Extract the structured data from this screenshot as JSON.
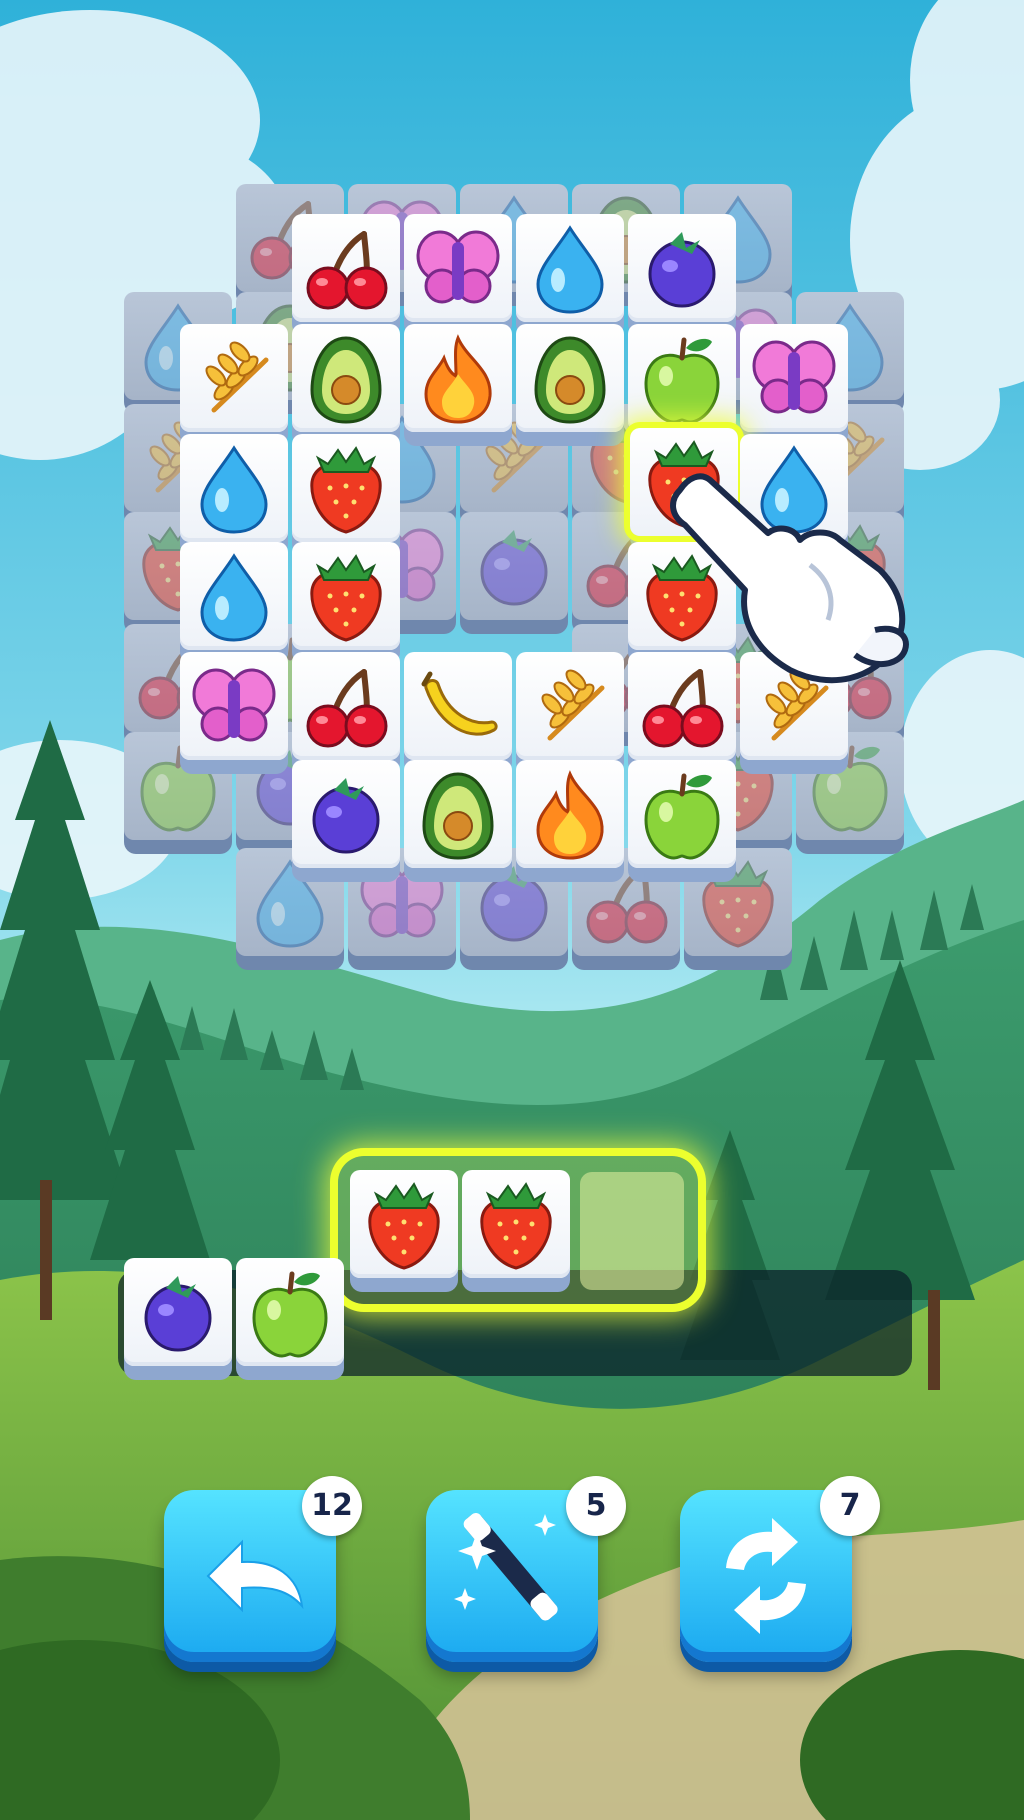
{
  "game": {
    "title": "",
    "highlight_color": "#ecff2e",
    "tray_color": "#0a1e28"
  },
  "boosters": {
    "undo": {
      "icon": "undo-arrow-icon",
      "count": "12"
    },
    "magic_wand": {
      "icon": "magic-wand-icon",
      "count": "5"
    },
    "shuffle": {
      "icon": "shuffle-icon",
      "count": "7"
    }
  },
  "tile_types": [
    "cherry",
    "butterfly",
    "water-drop",
    "blueberry",
    "wheat",
    "avocado",
    "flame",
    "apple",
    "strawberry",
    "banana"
  ],
  "board": {
    "back_tiles": [
      "cherry",
      "butterfly",
      "water-drop",
      "avocado",
      "water-drop",
      "water-drop",
      "avocado",
      "butterfly",
      "water-drop",
      "wheat",
      "water-drop",
      "wheat",
      "strawberry",
      "wheat",
      "strawberry",
      "butterfly",
      "blueberry",
      "cherry",
      "strawberry",
      "cherry",
      "apple",
      "cherry",
      "strawberry",
      "cherry",
      "apple",
      "blueberry",
      "strawberry",
      "apple",
      "water-drop",
      "butterfly",
      "blueberry",
      "cherry",
      "strawberry"
    ],
    "front_tiles": [
      "cherry",
      "butterfly",
      "water-drop",
      "blueberry",
      "wheat",
      "avocado",
      "flame",
      "avocado",
      "apple",
      "butterfly",
      "water-drop",
      "strawberry",
      "strawberry",
      "water-drop",
      "water-drop",
      "strawberry",
      "strawberry",
      "butterfly",
      "cherry",
      "banana",
      "wheat",
      "cherry",
      "wheat",
      "blueberry",
      "avocado",
      "flame",
      "apple"
    ],
    "highlighted_tile": "strawberry"
  },
  "tray": {
    "capacity": 7,
    "collected": [
      "blueberry",
      "apple"
    ],
    "incoming": [
      "strawberry",
      "strawberry"
    ]
  },
  "tutorial": {
    "pointer_icon": "pointing-hand-icon"
  }
}
